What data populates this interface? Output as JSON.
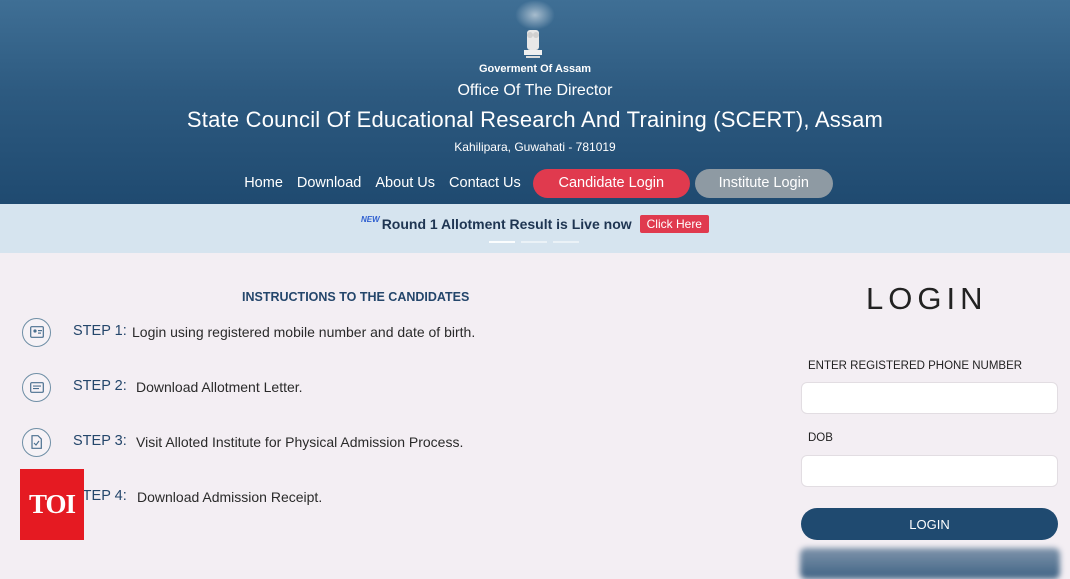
{
  "header": {
    "gov": "Goverment Of Assam",
    "office": "Office Of The Director",
    "council": "State Council Of Educational Research And Training (SCERT), Assam",
    "address": "Kahilipara, Guwahati - 781019"
  },
  "nav": {
    "home": "Home",
    "download": "Download",
    "about": "About Us",
    "contact": "Contact Us",
    "candidate_login": "Candidate Login",
    "institute_login": "Institute Login"
  },
  "announcement": {
    "badge": "NEW",
    "text": "Round 1 Allotment Result is Live now",
    "button": "Click Here"
  },
  "instructions": {
    "title": "INSTRUCTIONS TO THE CANDIDATES",
    "steps": [
      {
        "label": "STEP 1:",
        "text": "Login using registered mobile number and date of birth.",
        "icon": "id-card-icon"
      },
      {
        "label": "STEP 2:",
        "text": "Download Allotment Letter.",
        "icon": "letter-icon"
      },
      {
        "label": "STEP 3:",
        "text": "Visit Alloted Institute for Physical Admission Process.",
        "icon": "document-icon"
      },
      {
        "label": "STEP 4:",
        "text": "Download Admission Receipt.",
        "icon": "receipt-icon"
      }
    ]
  },
  "watermark": {
    "text": "TOI",
    "color": "#e51a22"
  },
  "login": {
    "heading": "LOGIN",
    "phone_label": "ENTER REGISTERED PHONE NUMBER",
    "phone_value": "",
    "dob_label": "DOB",
    "dob_value": "",
    "button": "LOGIN"
  },
  "colors": {
    "header_bg": "#2d5a80",
    "accent_red": "#e03a4e",
    "institute_gray": "#8e9aa3",
    "login_button": "#1f4a70"
  }
}
